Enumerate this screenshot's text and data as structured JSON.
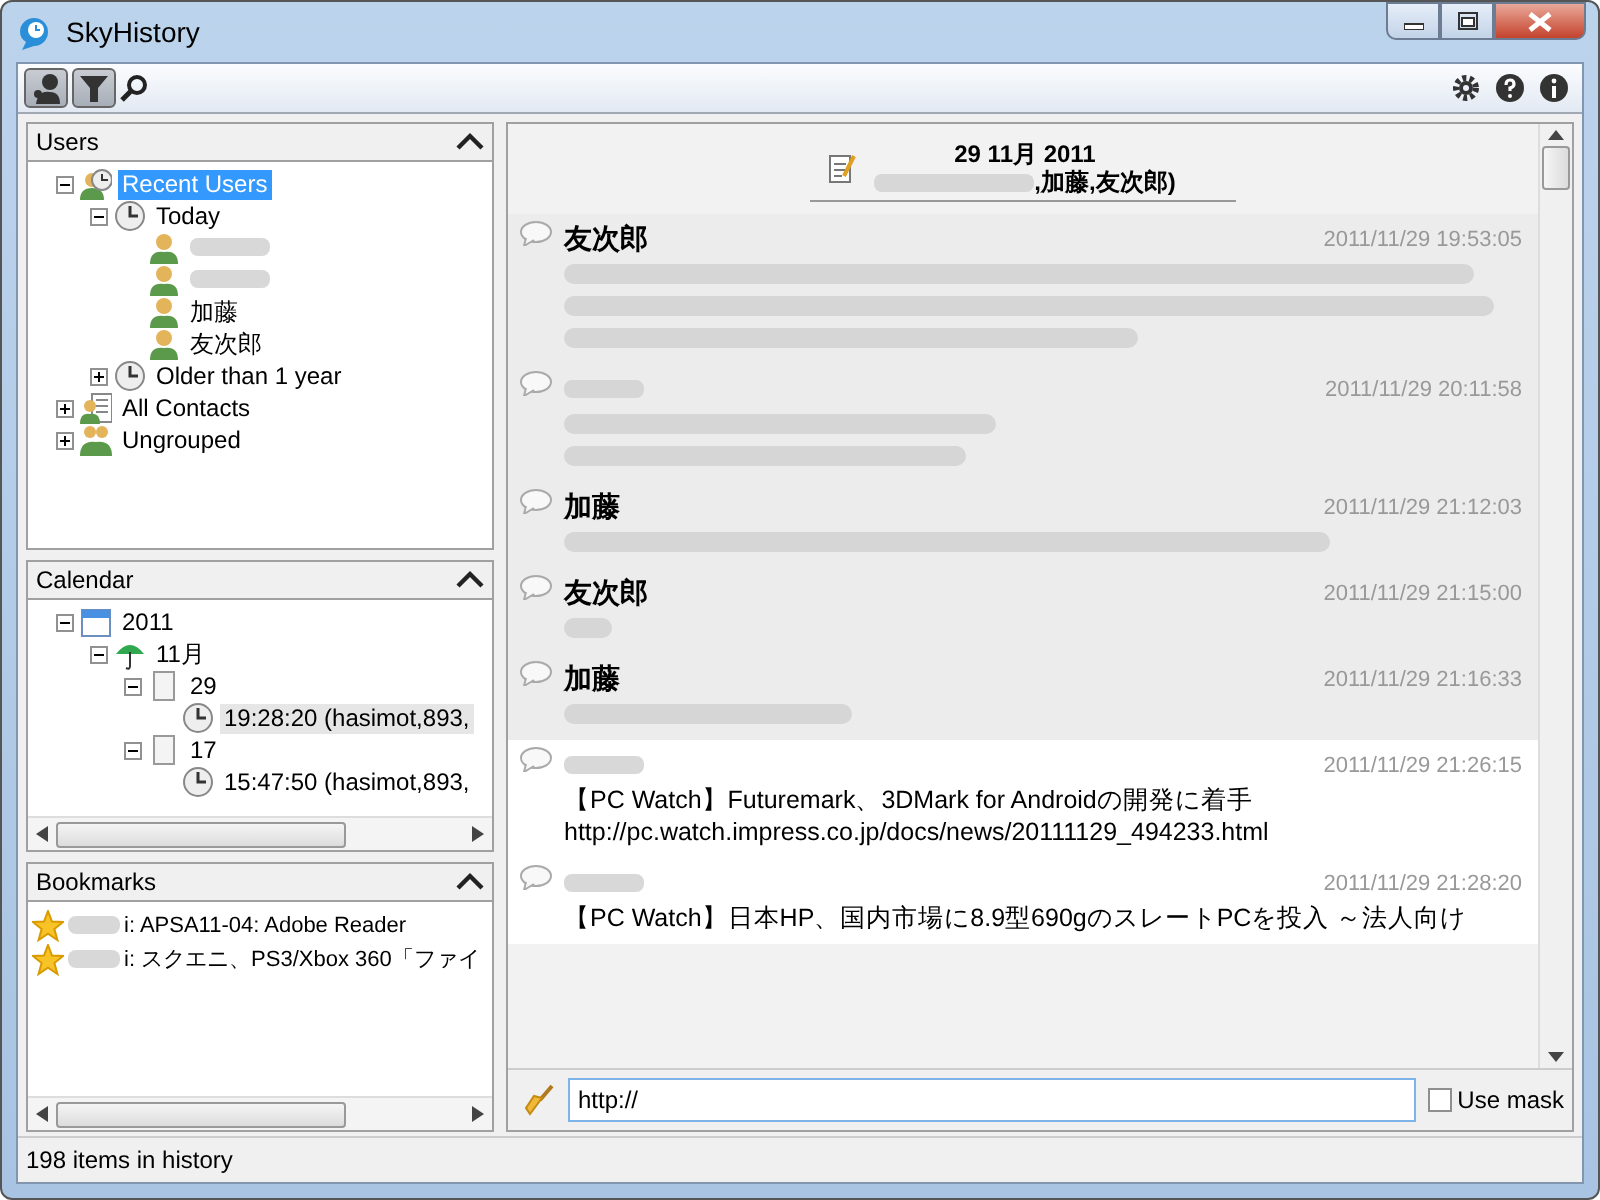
{
  "window": {
    "title": "SkyHistory"
  },
  "toolbar": {
    "toggles": [
      {
        "kind": "users",
        "selected": true
      },
      {
        "kind": "filter",
        "selected": true
      }
    ]
  },
  "users_panel": {
    "title": "Users",
    "nodes": [
      {
        "label": "Recent Users",
        "kind": "users-recent",
        "expanded": true,
        "selected": true,
        "children": [
          {
            "label": "Today",
            "kind": "clock",
            "expanded": true,
            "selected": false,
            "children": [
              {
                "kind": "user",
                "selected": false
              },
              {
                "kind": "user",
                "selected": false
              },
              {
                "label": "加藤",
                "kind": "user",
                "selected": false
              },
              {
                "label": "友次郎",
                "kind": "user",
                "selected": false
              }
            ]
          },
          {
            "label": "Older than 1 year",
            "kind": "clock",
            "expanded": false,
            "selected": false
          }
        ]
      },
      {
        "label": "All Contacts",
        "kind": "contacts",
        "expanded": false,
        "selected": false
      },
      {
        "label": "Ungrouped",
        "kind": "group",
        "expanded": false,
        "selected": false
      }
    ]
  },
  "calendar_panel": {
    "title": "Calendar",
    "nodes": [
      {
        "label": "2011",
        "kind": "calendar",
        "expanded": true,
        "selected": false,
        "children": [
          {
            "label": "11月",
            "kind": "umbrella",
            "expanded": true,
            "selected": false,
            "children": [
              {
                "label": "29",
                "kind": "page",
                "expanded": true,
                "selected": false,
                "children": [
                  {
                    "label": "19:28:20 (hasimot,893,",
                    "kind": "clock",
                    "selected": true
                  }
                ]
              },
              {
                "label": "17",
                "kind": "page",
                "expanded": true,
                "selected": false,
                "children": [
                  {
                    "label": "15:47:50 (hasimot,893,",
                    "kind": "clock",
                    "selected": false
                  }
                ]
              }
            ]
          }
        ]
      }
    ]
  },
  "bookmarks_panel": {
    "title": "Bookmarks",
    "items": [
      {
        "text": "i: APSA11-04: Adobe Reader"
      },
      {
        "text": "i: スクエニ、PS3/Xbox 360「ファイ"
      }
    ]
  },
  "conversation": {
    "date": "29 11月 2011",
    "participants": ",加藤,友次郎)",
    "messages": [
      {
        "kind": "redacted",
        "sender": "友次郎",
        "time": "2011/11/29 19:53:05",
        "highlighted": false
      },
      {
        "kind": "redacted",
        "time": "2011/11/29 20:11:58",
        "highlighted": false
      },
      {
        "kind": "redacted",
        "sender": "加藤",
        "time": "2011/11/29 21:12:03",
        "highlighted": false
      },
      {
        "kind": "redacted",
        "sender": "友次郎",
        "time": "2011/11/29 21:15:00",
        "highlighted": false
      },
      {
        "kind": "redacted",
        "sender": "加藤",
        "time": "2011/11/29 21:16:33",
        "highlighted": false
      },
      {
        "kind": "text",
        "time": "2011/11/29 21:26:15",
        "highlighted": true,
        "lines": [
          "【PC Watch】Futuremark、3DMark for Androidの開発に着手",
          "http://pc.watch.impress.co.jp/docs/news/20111129_494233.html"
        ]
      },
      {
        "kind": "text",
        "time": "2011/11/29 21:28:20",
        "highlighted": true,
        "lines": [
          "【PC Watch】日本HP、国内市場に8.9型690gのスレートPCを投入 ～法人向け"
        ]
      }
    ]
  },
  "filter": {
    "value": "http://",
    "use_mask": {
      "label": "Use mask",
      "checked": false
    }
  },
  "status_bar": {
    "text": "198 items in history"
  }
}
